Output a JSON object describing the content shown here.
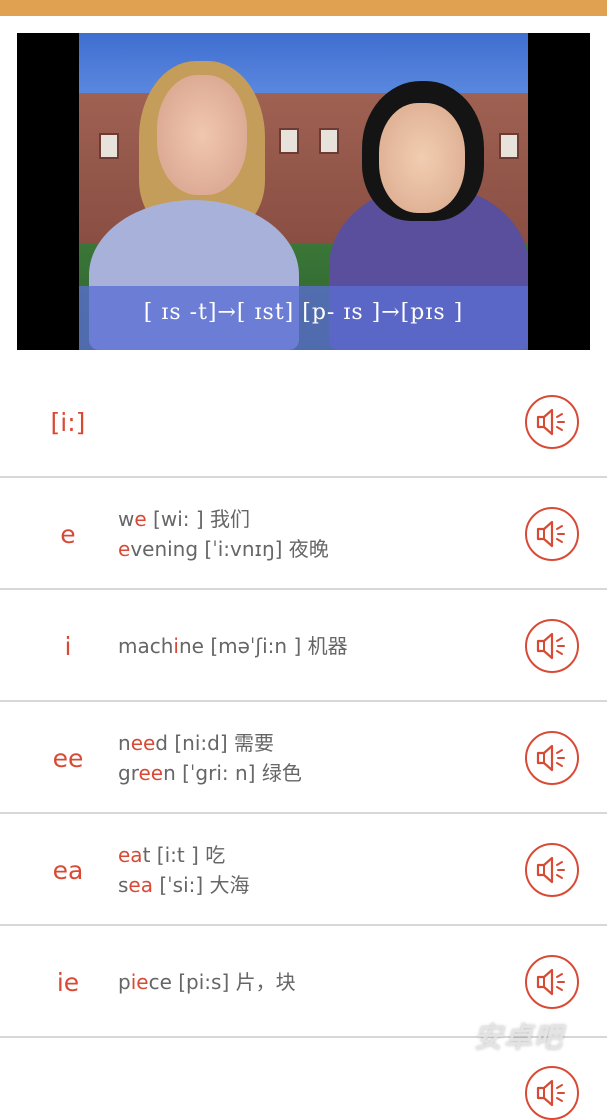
{
  "video": {
    "caption": "[ ɪs -t]→[ ɪst]  [p- ɪs ]→[pɪs ]"
  },
  "phonics": {
    "header_symbol": "[i:]",
    "rows": [
      {
        "letters": "e",
        "words": [
          {
            "pre": "w",
            "hl": "e",
            "post": " [wi: ] 我们"
          },
          {
            "pre": "",
            "hl": "e",
            "post": "vening [ˈi:vnɪŋ] 夜晚"
          }
        ]
      },
      {
        "letters": "i",
        "words": [
          {
            "pre": "mach",
            "hl": "i",
            "post": "ne [məˈʃi:n ] 机器"
          }
        ]
      },
      {
        "letters": "ee",
        "words": [
          {
            "pre": "n",
            "hl": "ee",
            "post": "d [ni:d] 需要"
          },
          {
            "pre": "gr",
            "hl": "ee",
            "post": "n [ˈgri: n] 绿色"
          }
        ]
      },
      {
        "letters": "ea",
        "words": [
          {
            "pre": "",
            "hl": "ea",
            "post": "t [i:t ] 吃"
          },
          {
            "pre": "s",
            "hl": "ea",
            "post": " [ˈsi:] 大海"
          }
        ]
      },
      {
        "letters": "ie",
        "words": [
          {
            "pre": "p",
            "hl": "ie",
            "post": "ce [pi:s] 片，块"
          }
        ]
      }
    ]
  },
  "watermark": "安卓吧",
  "icons": {
    "speaker": "speaker-icon"
  },
  "colors": {
    "accent": "#d94a35",
    "topbar": "#e0a250",
    "divider": "#d7d7d7",
    "text": "#666666"
  }
}
